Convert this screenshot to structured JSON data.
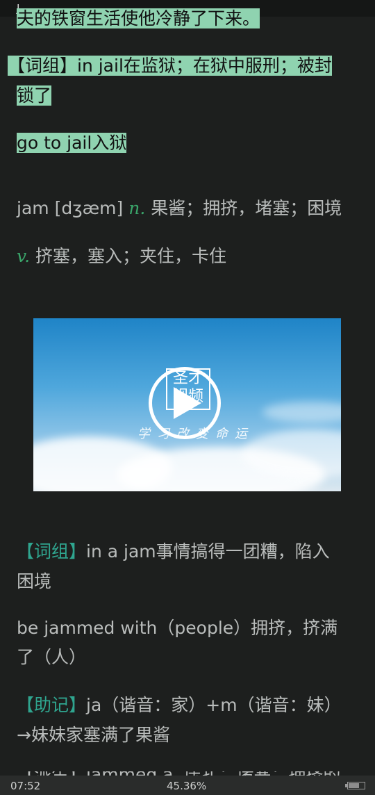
{
  "status_top": {
    "char": "J"
  },
  "entries": {
    "jail_sentence_tail": "夫的铁窗生活使他冷静了下来。",
    "jail_phrase_1": "【词组】in jail在监狱；在狱中服刑；被封",
    "jail_phrase_1_cont": "锁了",
    "jail_phrase_2": "go to jail入狱",
    "jam_word": "jam [dʒæm] ",
    "jam_pos_n": "n.",
    "jam_meaning_n": " 果酱；拥挤，堵塞；困境",
    "jam_pos_v": "v.",
    "jam_meaning_v": " 挤塞，塞入；夹住，卡住",
    "jam_phrase_tag": "【词组】",
    "jam_phrase_1": "in a jam事情搞得一团糟，陷入",
    "jam_phrase_1_cont": "困境",
    "jam_phrase_2": "be jammed with（people）拥挤，挤满",
    "jam_phrase_2_cont": "了（人）",
    "jam_mnemonic_tag": "【助记】",
    "jam_mnemonic": "ja（谐音：家）+m（谐音：妹）",
    "jam_mnemonic_cont": "→妹妹家塞满了果酱",
    "next_partial": "【派生】jammed  a. 压扎；堵塞；拥挤的"
  },
  "video": {
    "logo_line1": "圣才",
    "logo_line2": "视频",
    "slogan": "学习改变命运",
    "play_icon": "play-circle-icon"
  },
  "status_bottom": {
    "time": "07:52",
    "progress": "45.36%",
    "battery_level": 0.7
  }
}
